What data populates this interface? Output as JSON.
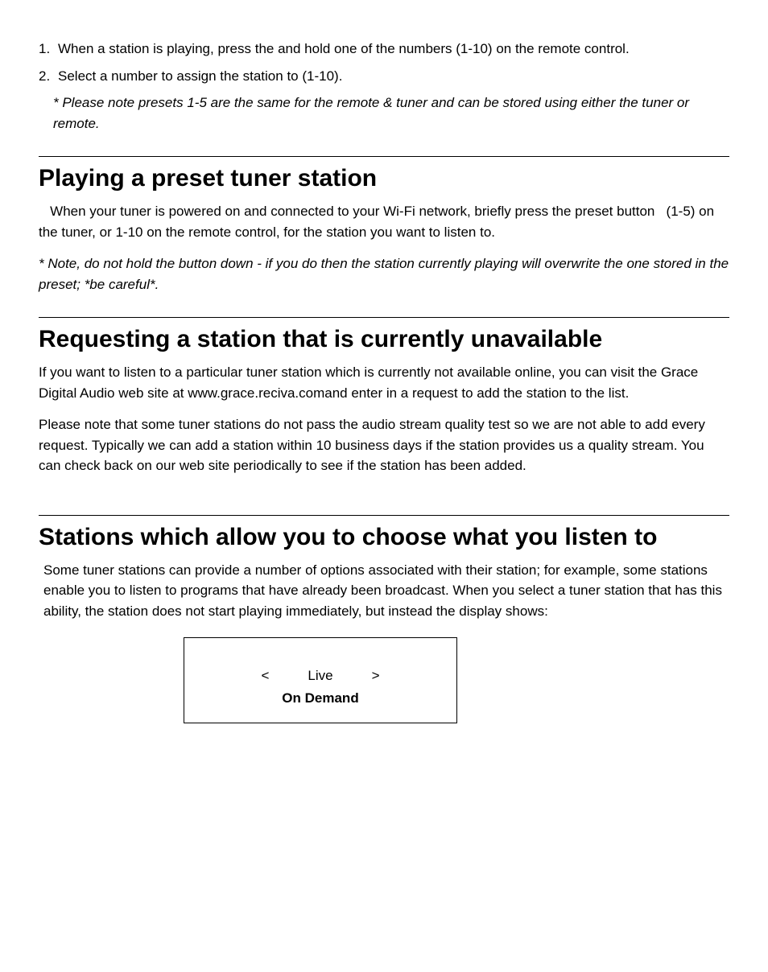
{
  "list": {
    "item1_num": "1.",
    "item1_text": " When a station is playing, press the and hold one of the numbers (1-10) on the remote control.",
    "item2_num": "2.",
    "item2_text": "Select a number to assign the station to (1-10).",
    "item_note": "* Please note presets 1-5 are the same for the remote & tuner and can be stored using either the tuner or remote."
  },
  "section1": {
    "heading": "Playing a preset tuner station",
    "para1": "   When your tuner is powered on and connected to your Wi-Fi network, briefly press the preset button   (1-5) on the tuner, or 1-10 on the remote control, for the station you want to listen to.",
    "note": "* Note, do not hold the button down - if you do then the station currently playing will overwrite the one stored in the preset; *be careful*."
  },
  "section2": {
    "heading": "Requesting a station that is currently unavailable",
    "para1": "If you want to listen to a particular tuner station which is currently not available online, you can visit the Grace Digital Audio web site at www.grace.reciva.comand enter in a request to add the station to the list.",
    "para2": "Please note that some tuner stations do not pass the audio stream quality test so we are not able to add every request. Typically we can add a station within 10 business days if the station provides us a quality stream. You can check back on our web site periodically to see if the station has been added."
  },
  "section3": {
    "heading": "Stations which allow you to choose what you listen to",
    "para1": "Some tuner stations can provide a number of options associated with their station; for example, some stations enable you to listen to programs that have already been broadcast. When you select a tuner station that has this ability, the station does not start playing immediately, but instead the display shows:"
  },
  "screen": {
    "left": "<",
    "middle": "Live",
    "right": ">",
    "line2": "On Demand"
  }
}
